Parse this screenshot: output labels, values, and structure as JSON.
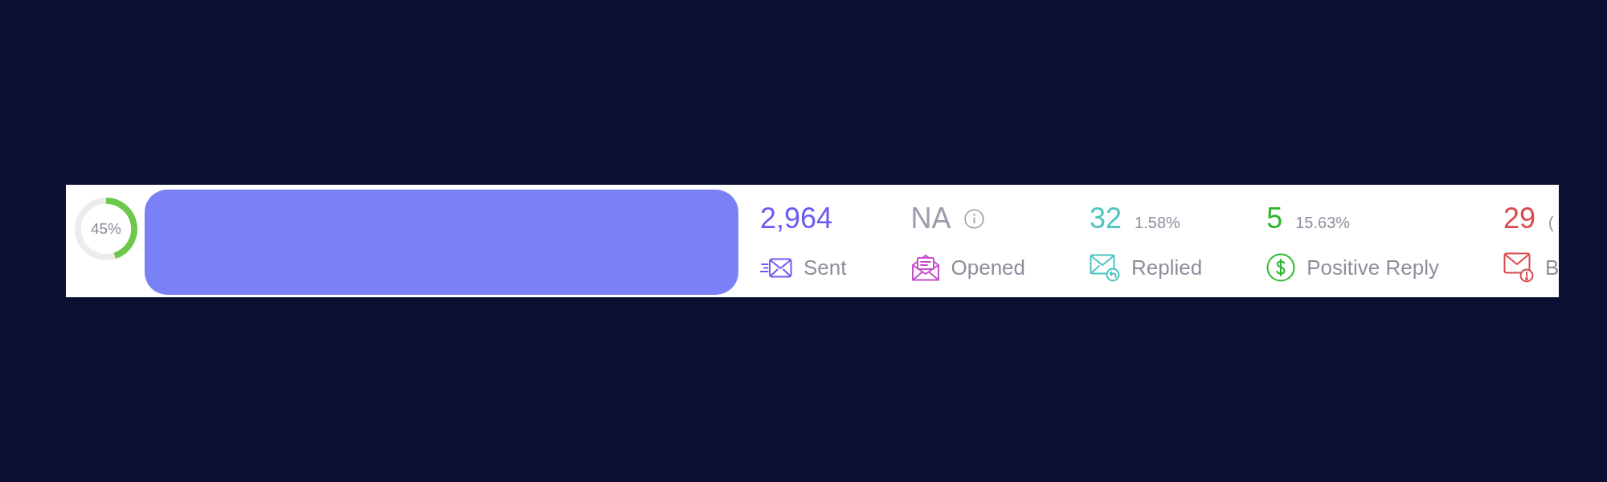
{
  "progress": {
    "label": "45%",
    "level": 0.45
  },
  "stats": [
    {
      "kind": "sent",
      "value": "2,964",
      "label": "Sent",
      "color": "#6c5cf0",
      "muted": false,
      "info": false
    },
    {
      "kind": "opened",
      "value": "NA",
      "label": "Opened",
      "color": "#c44fca",
      "muted": true,
      "info": true
    },
    {
      "kind": "replied",
      "value": "32",
      "percent": "1.58%",
      "label": "Replied",
      "color": "#4cc4c0",
      "muted": false,
      "info": false
    },
    {
      "kind": "positive",
      "value": "5",
      "percent": "15.63%",
      "label": "Positive Reply",
      "color": "#2db82d",
      "muted": false,
      "info": false
    },
    {
      "kind": "bounced",
      "value": "29",
      "percent": "(",
      "label": "B",
      "color": "#d84a4d",
      "muted": false,
      "info": false
    }
  ]
}
